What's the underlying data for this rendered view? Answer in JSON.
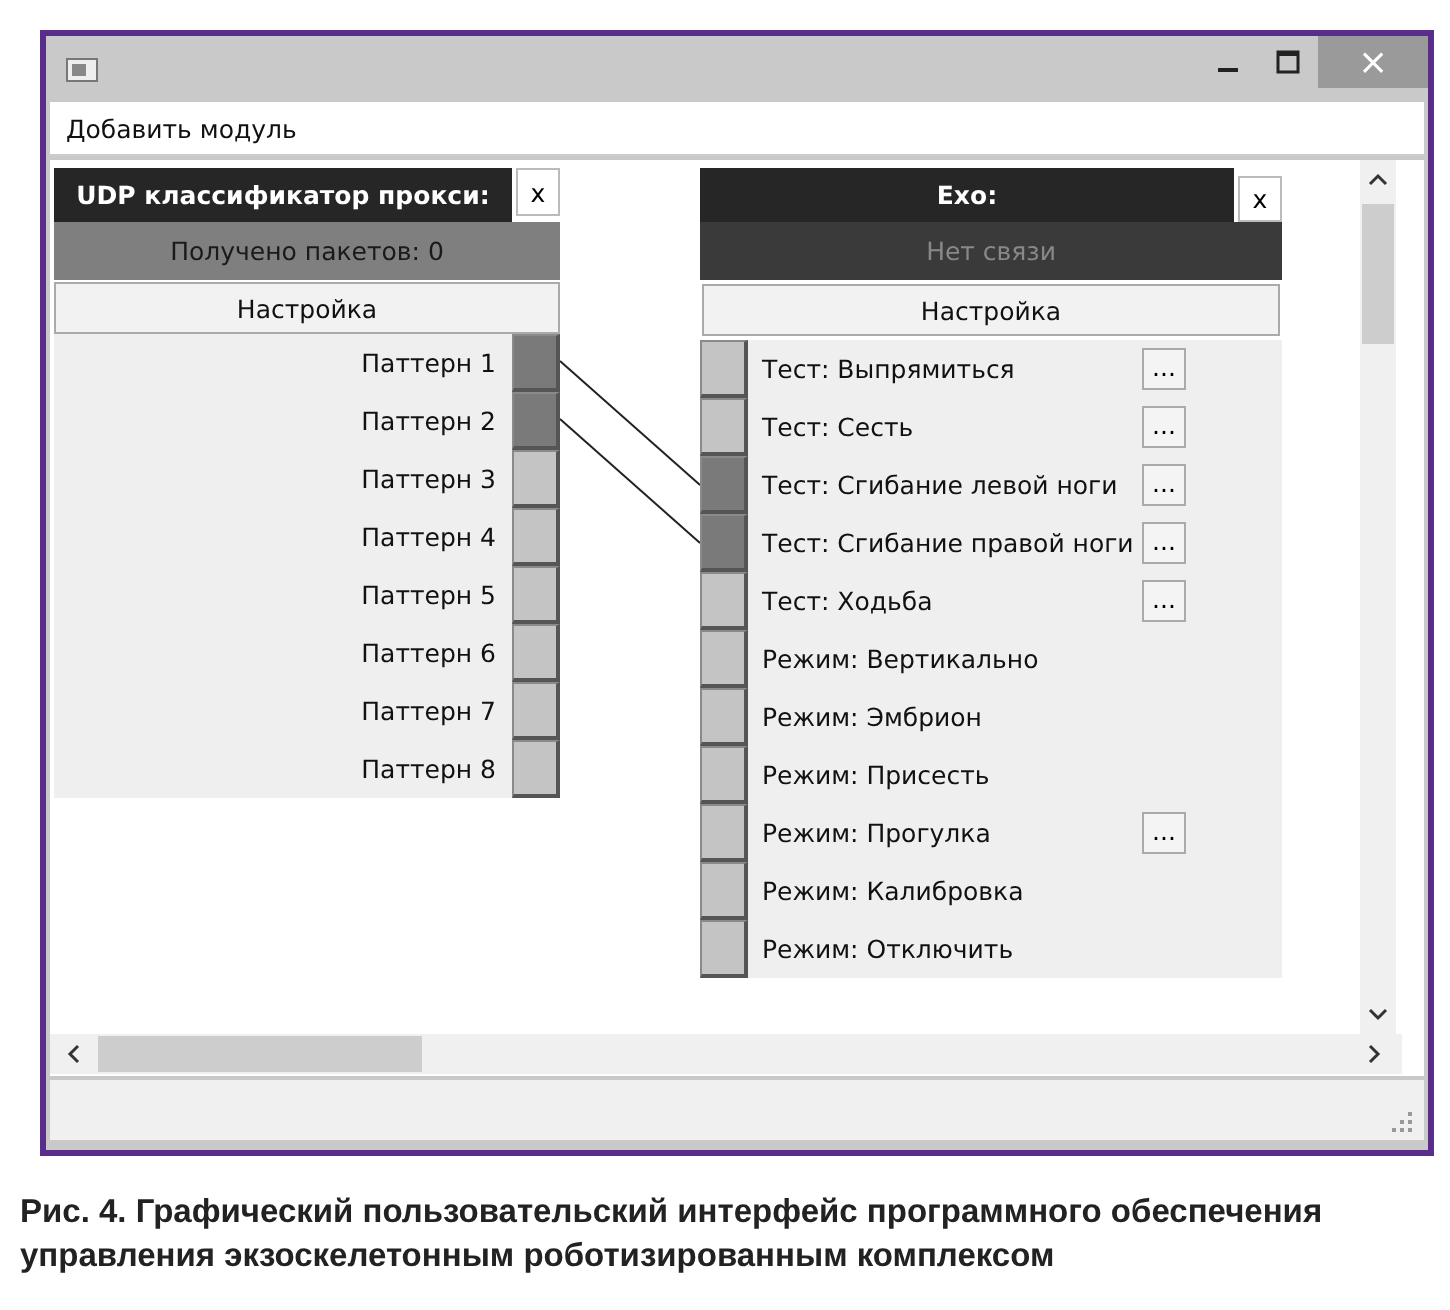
{
  "window": {
    "close_symbol": "×"
  },
  "menu": [
    {
      "label": "Добавить модуль"
    }
  ],
  "modules": [
    {
      "title": "UDP классификатор прокси:",
      "close_label": "x",
      "status": "Получено пакетов: 0",
      "settings_label": "Настройка",
      "kind": "output",
      "rows": [
        {
          "label": "Паттерн 1",
          "connected": true
        },
        {
          "label": "Паттерн 2",
          "connected": true
        },
        {
          "label": "Паттерн 3",
          "connected": false
        },
        {
          "label": "Паттерн 4",
          "connected": false
        },
        {
          "label": "Паттерн 5",
          "connected": false
        },
        {
          "label": "Паттерн 6",
          "connected": false
        },
        {
          "label": "Паттерн 7",
          "connected": false
        },
        {
          "label": "Паттерн 8",
          "connected": false
        }
      ]
    },
    {
      "title": "Exo:",
      "close_label": "x",
      "status": "Нет связи",
      "settings_label": "Настройка",
      "kind": "input",
      "rows": [
        {
          "label": "Тест: Выпрямиться",
          "connected": false,
          "more_label": "..."
        },
        {
          "label": "Тест: Сесть",
          "connected": false,
          "more_label": "..."
        },
        {
          "label": "Тест: Сгибание левой ноги",
          "connected": true,
          "more_label": "..."
        },
        {
          "label": "Тест: Сгибание правой ноги",
          "connected": true,
          "more_label": "..."
        },
        {
          "label": "Тест: Ходьба",
          "connected": false,
          "more_label": "..."
        },
        {
          "label": "Режим: Вертикально",
          "connected": false
        },
        {
          "label": "Режим: Эмбрион",
          "connected": false
        },
        {
          "label": "Режим: Присесть",
          "connected": false
        },
        {
          "label": "Режим: Прогулка",
          "connected": false,
          "more_label": "..."
        },
        {
          "label": "Режим: Калибровка",
          "connected": false
        },
        {
          "label": "Режим: Отключить",
          "connected": false
        }
      ]
    }
  ],
  "caption": "Рис. 4. Графический пользовательский интерфейс программного обеспечения управления экзоскелетонным роботизированным комплексом"
}
